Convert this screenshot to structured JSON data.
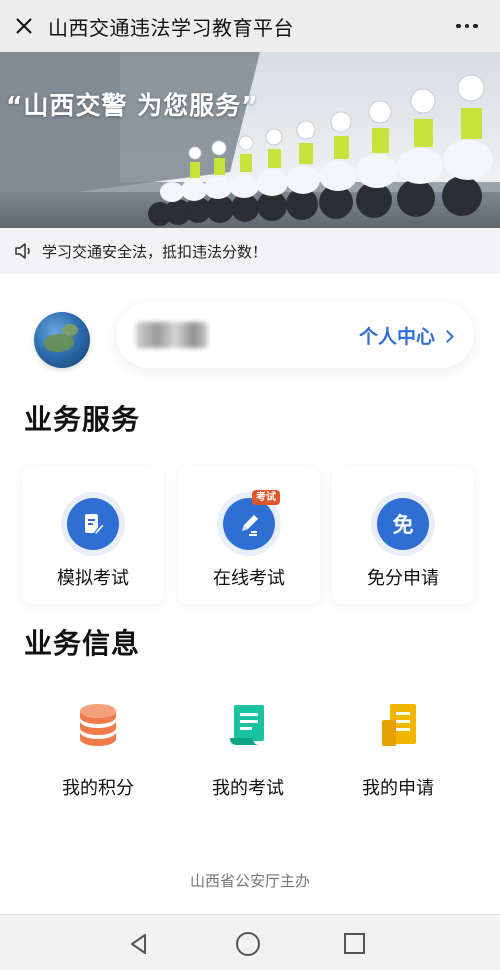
{
  "header": {
    "title": "山西交通违法学习教育平台",
    "close_icon": "close-icon",
    "more_icon": "more-dots-icon"
  },
  "banner": {
    "slogan": "“山西交警 为您服务”"
  },
  "notice": {
    "icon": "speaker-icon",
    "text": "学习交通安全法，抵扣违法分数！"
  },
  "user": {
    "center_link": "个人中心"
  },
  "services": {
    "title": "业务服务",
    "items": [
      {
        "label": "模拟考试",
        "icon": "mock-exam-icon"
      },
      {
        "label": "在线考试",
        "icon": "pen-icon",
        "badge": "考试"
      },
      {
        "label": "免分申请",
        "icon": "exempt-icon",
        "glyph": "免"
      }
    ]
  },
  "info": {
    "title": "业务信息",
    "items": [
      {
        "label": "我的积分",
        "icon": "coins-icon"
      },
      {
        "label": "我的考试",
        "icon": "scroll-icon"
      },
      {
        "label": "我的申请",
        "icon": "document-icon"
      }
    ]
  },
  "footer": {
    "text": "山西省公安厅主办"
  },
  "colors": {
    "accent": "#2f6fd3",
    "badge": "#e0552b",
    "coins": "#f07a4a",
    "scroll": "#19c3a0",
    "document": "#f2b600"
  }
}
